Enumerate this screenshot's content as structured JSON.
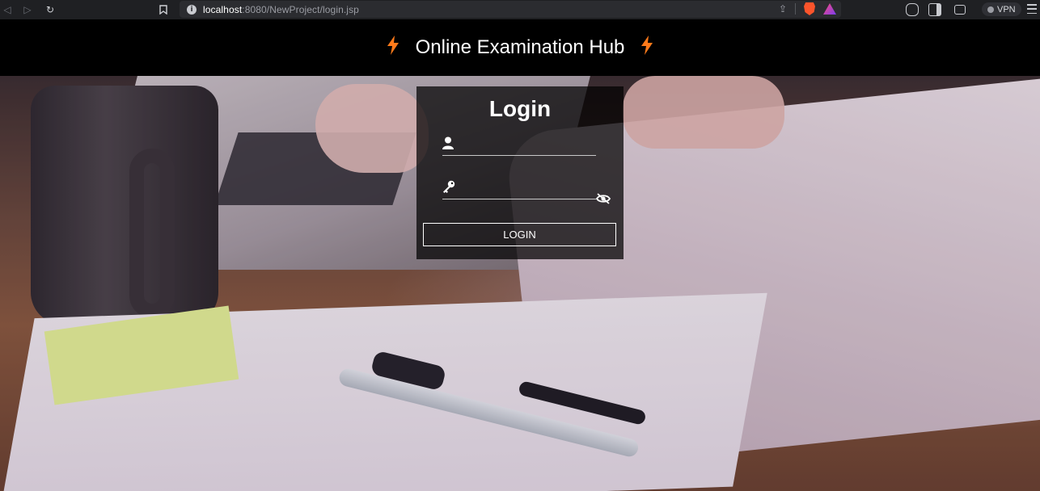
{
  "browser": {
    "url_host": "localhost",
    "url_path": ":8080/NewProject/login.jsp",
    "vpn_label": "VPN",
    "icons": [
      "back-icon",
      "forward-icon",
      "reload-icon",
      "bookmark-icon",
      "info-icon",
      "share-icon",
      "brave-shields-icon",
      "brave-rewards-icon",
      "extensions-icon",
      "sidebar-icon",
      "wallet-icon",
      "menu-icon"
    ]
  },
  "header": {
    "title": "Online Examination Hub",
    "bolt_color": "#ff7a1a"
  },
  "login": {
    "title": "Login",
    "username_value": "",
    "password_value": "",
    "button_label": "LOGIN",
    "icons": [
      "user-icon",
      "key-icon",
      "eye-slash-icon"
    ]
  }
}
